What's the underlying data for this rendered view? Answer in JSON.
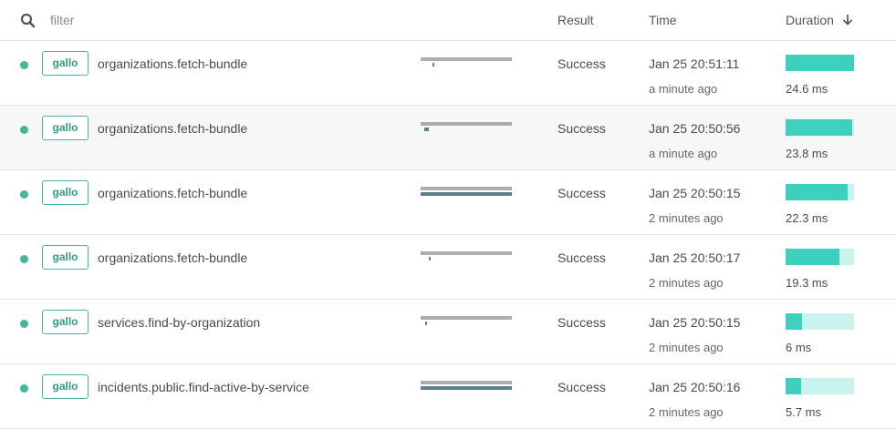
{
  "header": {
    "filter_placeholder": "filter",
    "result_label": "Result",
    "time_label": "Time",
    "duration_label": "Duration"
  },
  "colors": {
    "status_dot": "#42b89a",
    "duration_fill": "#3dd0bf",
    "duration_track": "#c9f4ee",
    "trace_track": "#adadad",
    "trace_span": "#5e7f8c"
  },
  "rows": [
    {
      "tag": "gallo",
      "operation": "organizations.fetch-bundle",
      "result": "Success",
      "time": "Jan 25 20:51:11",
      "relative": "a minute ago",
      "duration": "24.6 ms",
      "duration_fraction": 1.0,
      "trace": {
        "start": 0.13,
        "length": 0.02,
        "full_span": false
      }
    },
    {
      "tag": "gallo",
      "operation": "organizations.fetch-bundle",
      "result": "Success",
      "time": "Jan 25 20:50:56",
      "relative": "a minute ago",
      "duration": "23.8 ms",
      "duration_fraction": 0.967,
      "trace": {
        "start": 0.04,
        "length": 0.05,
        "full_span": false
      }
    },
    {
      "tag": "gallo",
      "operation": "organizations.fetch-bundle",
      "result": "Success",
      "time": "Jan 25 20:50:15",
      "relative": "2 minutes ago",
      "duration": "22.3 ms",
      "duration_fraction": 0.906,
      "trace": {
        "start": 0.0,
        "length": 1.0,
        "full_span": true
      }
    },
    {
      "tag": "gallo",
      "operation": "organizations.fetch-bundle",
      "result": "Success",
      "time": "Jan 25 20:50:17",
      "relative": "2 minutes ago",
      "duration": "19.3 ms",
      "duration_fraction": 0.785,
      "trace": {
        "start": 0.09,
        "length": 0.02,
        "full_span": false
      }
    },
    {
      "tag": "gallo",
      "operation": "services.find-by-organization",
      "result": "Success",
      "time": "Jan 25 20:50:15",
      "relative": "2 minutes ago",
      "duration": "6 ms",
      "duration_fraction": 0.244,
      "trace": {
        "start": 0.05,
        "length": 0.02,
        "full_span": false
      }
    },
    {
      "tag": "gallo",
      "operation": "incidents.public.find-active-by-service",
      "result": "Success",
      "time": "Jan 25 20:50:16",
      "relative": "2 minutes ago",
      "duration": "5.7 ms",
      "duration_fraction": 0.232,
      "trace": {
        "start": 0.0,
        "length": 1.0,
        "full_span": true
      }
    }
  ]
}
